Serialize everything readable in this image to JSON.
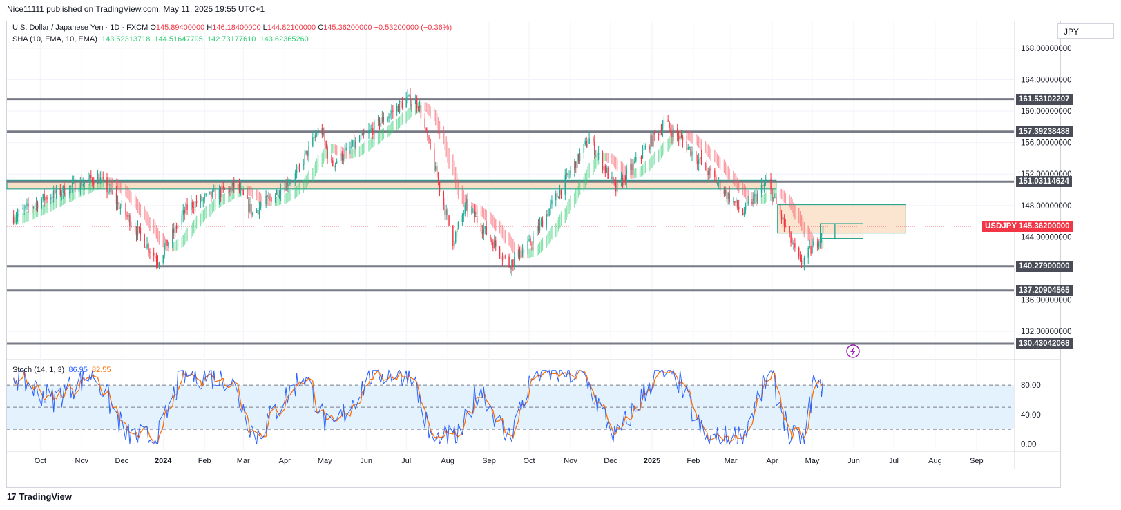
{
  "publisher_line": "Nice11111 published on TradingView.com, May 11, 2025 19:55 UTC+1",
  "legend": {
    "symbol": "U.S. Dollar / Japanese Yen · 1D · FXCM",
    "o_label": "O",
    "o_value": "145.89400000",
    "h_label": "H",
    "h_value": "146.18400000",
    "l_label": "L",
    "l_value": "144.82100000",
    "c_label": "C",
    "c_value": "145.36200000",
    "change": "−0.53200000 (−0.36%)",
    "sha_label": "SHA (10, EMA, 10, EMA)",
    "sha_values": [
      "143.52313718",
      "144.51647795",
      "142.73177610",
      "143.62365260"
    ],
    "stoch_label": "Stoch (14, 1, 3)",
    "stoch_k": "86.95",
    "stoch_d": "82.55"
  },
  "currency": "JPY",
  "current_symbol": "USDJPY",
  "footer_brand": "TradingView",
  "colors": {
    "up": "#22ab94",
    "down": "#f23645",
    "sha_up": "#2ecc71",
    "sha_down": "#f7525f",
    "level": "#787b86",
    "zone_fill": "#f9dcc1",
    "zone_border": "#089981",
    "stoch_k": "#2962ff",
    "stoch_d": "#ff6d00",
    "stoch_band": "#e3f2fd"
  },
  "chart_data": [
    {
      "type": "candlestick",
      "title": "U.S. Dollar / Japanese Yen · 1D · FXCM",
      "price_axis_ticks": [
        "168.00000000",
        "164.00000000",
        "160.00000000",
        "156.00000000",
        "152.00000000",
        "148.00000000",
        "144.00000000",
        "136.00000000",
        "132.00000000"
      ],
      "price_range": [
        128.5,
        171.5
      ],
      "time_axis_labels": [
        "Oct",
        "Nov",
        "Dec",
        "2024",
        "Feb",
        "Mar",
        "Apr",
        "May",
        "Jun",
        "Jul",
        "Aug",
        "Sep",
        "Oct",
        "Nov",
        "Dec",
        "2025",
        "Feb",
        "Mar",
        "Apr",
        "May",
        "Jun",
        "Jul",
        "Aug",
        "Sep"
      ],
      "time_axis_values": [
        "2023-10",
        "2023-11",
        "2023-12",
        "2024-01",
        "2024-02",
        "2024-03",
        "2024-04",
        "2024-05",
        "2024-06",
        "2024-07",
        "2024-08",
        "2024-09",
        "2024-10",
        "2024-11",
        "2024-12",
        "2025-01",
        "2025-02",
        "2025-03",
        "2025-04",
        "2025-05",
        "2025-06",
        "2025-07",
        "2025-08",
        "2025-09"
      ],
      "horizontal_levels": [
        {
          "label": "161.53102207",
          "value": 161.53102207
        },
        {
          "label": "157.39238488",
          "value": 157.39238488
        },
        {
          "label": "151.03114624",
          "value": 151.03114624
        },
        {
          "label": "140.27900000",
          "value": 140.279
        },
        {
          "label": "137.20904565",
          "value": 137.20904565
        },
        {
          "label": "130.43042068",
          "value": 130.43042068
        }
      ],
      "current_price": {
        "label": "145.36200000",
        "value": 145.362
      },
      "zones": [
        {
          "from": "2023-09",
          "to": "2025-04",
          "low": 150.1,
          "high": 151.2
        },
        {
          "from": "2025-04",
          "to": "2025-07",
          "low": 144.5,
          "high": 148.1
        },
        {
          "from": "2025-05",
          "to": "2025-05",
          "low": 143.8,
          "high": 145.7
        },
        {
          "from": "2025-05",
          "to": "2025-06",
          "low": 143.8,
          "high": 145.7
        }
      ],
      "price_path_monthly": [
        {
          "date": "2023-09",
          "close": 146.5
        },
        {
          "date": "2023-10",
          "close": 149.5
        },
        {
          "date": "2023-11",
          "close": 150.8
        },
        {
          "date": "2023-12",
          "close": 141.0
        },
        {
          "date": "2024-01",
          "close": 147.0
        },
        {
          "date": "2024-02",
          "close": 150.2
        },
        {
          "date": "2024-03",
          "close": 151.4
        },
        {
          "date": "2024-04",
          "close": 157.5
        },
        {
          "date": "2024-05",
          "close": 157.0
        },
        {
          "date": "2024-06",
          "close": 160.8
        },
        {
          "date": "2024-07",
          "close": 150.5
        },
        {
          "date": "2024-08",
          "close": 146.5
        },
        {
          "date": "2024-09",
          "close": 141.5
        },
        {
          "date": "2024-10",
          "close": 152.0
        },
        {
          "date": "2024-11",
          "close": 150.0
        },
        {
          "date": "2024-12",
          "close": 157.3
        },
        {
          "date": "2025-01",
          "close": 155.0
        },
        {
          "date": "2025-02",
          "close": 150.5
        },
        {
          "date": "2025-03",
          "close": 149.8
        },
        {
          "date": "2025-04",
          "close": 143.0
        },
        {
          "date": "2025-05",
          "close": 145.36
        }
      ],
      "price_anchors": [
        {
          "date": "2023-09-10",
          "value": 146.5
        },
        {
          "date": "2023-10-05",
          "value": 149.0
        },
        {
          "date": "2023-11-13",
          "value": 151.7
        },
        {
          "date": "2023-11-25",
          "value": 149.0
        },
        {
          "date": "2023-12-28",
          "value": 141.0
        },
        {
          "date": "2024-01-20",
          "value": 148.0
        },
        {
          "date": "2024-02-25",
          "value": 150.5
        },
        {
          "date": "2024-03-08",
          "value": 147.0
        },
        {
          "date": "2024-04-10",
          "value": 152.0
        },
        {
          "date": "2024-04-28",
          "value": 158.2
        },
        {
          "date": "2024-05-05",
          "value": 153.0
        },
        {
          "date": "2024-06-01",
          "value": 157.0
        },
        {
          "date": "2024-07-01",
          "value": 161.5
        },
        {
          "date": "2024-07-10",
          "value": 161.0
        },
        {
          "date": "2024-08-05",
          "value": 143.5
        },
        {
          "date": "2024-08-15",
          "value": 148.0
        },
        {
          "date": "2024-09-16",
          "value": 140.5
        },
        {
          "date": "2024-10-01",
          "value": 143.0
        },
        {
          "date": "2024-11-15",
          "value": 156.5
        },
        {
          "date": "2024-12-05",
          "value": 150.0
        },
        {
          "date": "2025-01-10",
          "value": 158.5
        },
        {
          "date": "2025-01-25",
          "value": 156.0
        },
        {
          "date": "2025-03-10",
          "value": 147.0
        },
        {
          "date": "2025-03-28",
          "value": 151.0
        },
        {
          "date": "2025-04-22",
          "value": 140.5
        },
        {
          "date": "2025-05-05",
          "value": 143.5
        },
        {
          "date": "2025-05-09",
          "value": 145.36
        }
      ]
    },
    {
      "type": "line",
      "title": "Stoch (14, 1, 3)",
      "axis_ticks": [
        "80.00",
        "40.00",
        "0.00"
      ],
      "ylim": [
        -8,
        112
      ],
      "band": [
        20,
        80
      ],
      "dashed_levels": [
        80,
        50,
        20
      ],
      "series": [
        {
          "name": "%K",
          "last": 86.95
        },
        {
          "name": "%D",
          "last": 82.55
        }
      ],
      "k_anchors": [
        {
          "date": "2023-09-10",
          "value": 95
        },
        {
          "date": "2023-10-10",
          "value": 60
        },
        {
          "date": "2023-11-10",
          "value": 98
        },
        {
          "date": "2023-12-05",
          "value": 10
        },
        {
          "date": "2023-12-28",
          "value": 8
        },
        {
          "date": "2024-01-15",
          "value": 95
        },
        {
          "date": "2024-02-20",
          "value": 90
        },
        {
          "date": "2024-03-10",
          "value": 10
        },
        {
          "date": "2024-04-15",
          "value": 95
        },
        {
          "date": "2024-05-05",
          "value": 15
        },
        {
          "date": "2024-06-05",
          "value": 95
        },
        {
          "date": "2024-07-05",
          "value": 98
        },
        {
          "date": "2024-07-20",
          "value": 3
        },
        {
          "date": "2024-08-10",
          "value": 10
        },
        {
          "date": "2024-08-25",
          "value": 80
        },
        {
          "date": "2024-09-15",
          "value": 5
        },
        {
          "date": "2024-10-05",
          "value": 98
        },
        {
          "date": "2024-11-10",
          "value": 95
        },
        {
          "date": "2024-12-05",
          "value": 8
        },
        {
          "date": "2025-01-05",
          "value": 98
        },
        {
          "date": "2025-01-20",
          "value": 90
        },
        {
          "date": "2025-02-10",
          "value": 5
        },
        {
          "date": "2025-03-10",
          "value": 10
        },
        {
          "date": "2025-03-30",
          "value": 98
        },
        {
          "date": "2025-04-15",
          "value": 8
        },
        {
          "date": "2025-04-25",
          "value": 3
        },
        {
          "date": "2025-05-03",
          "value": 95
        },
        {
          "date": "2025-05-06",
          "value": 70
        },
        {
          "date": "2025-05-09",
          "value": 86.95
        }
      ]
    }
  ]
}
